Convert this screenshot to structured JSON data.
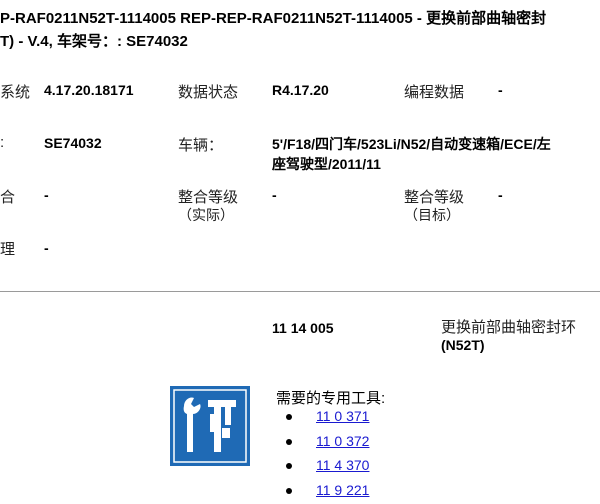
{
  "header": {
    "line1": "P-RAF0211N52T-1114005   REP-REP-RAF0211N52T-1114005 - 更换前部曲轴密封",
    "line2": "T) - V.4,  车架号：: SE74032"
  },
  "info": {
    "row1": {
      "label_left": "系统",
      "value_left": "4.17.20.18171",
      "label_mid": "数据状态",
      "value_mid": "R4.17.20",
      "label_right": "编程数据",
      "value_right": "-"
    },
    "row2": {
      "label_left": ":",
      "value_left": "SE74032",
      "label_mid": "车辆：",
      "value_mid_1": "5'/F18/四门车/523Li/N52/自动变速箱/ECE/左",
      "value_mid_2": "座驾驶型/2011/11"
    },
    "row3": {
      "label_left": "合",
      "value_left": "-",
      "label_mid": "整合等级",
      "label_mid_sub": "（实际）",
      "value_mid": "-",
      "label_right": "整合等级",
      "label_right_sub": "（目标）",
      "value_right": "-"
    },
    "row4": {
      "label_left": "理",
      "value_left": "-"
    }
  },
  "repair": {
    "code": "11 14 005",
    "title_1": "更换前部曲轴密封环",
    "title_2": "(N52T)"
  },
  "tools": {
    "heading": "需要的专用工具:",
    "items": [
      "11 0 371",
      "11 0 372",
      "11 4 370",
      "11 9 221"
    ],
    "icon": "special-tools-icon",
    "icon_color": "#1f6ab5"
  }
}
